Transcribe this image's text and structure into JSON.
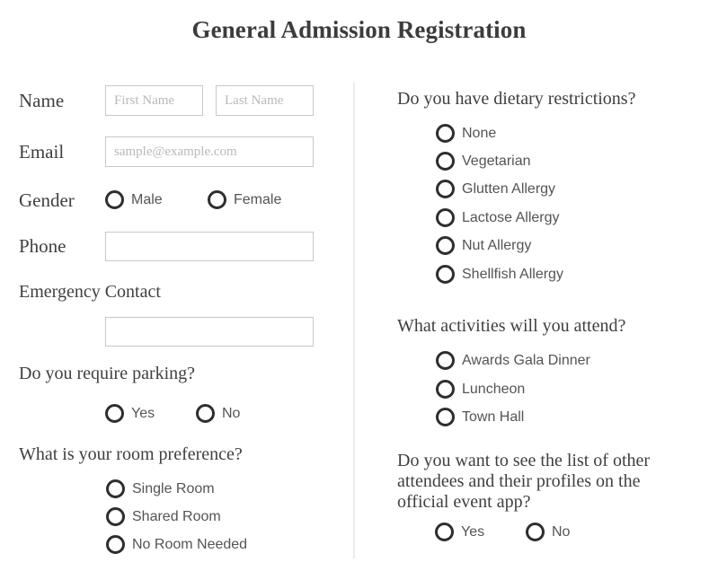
{
  "title": "General Admission Registration",
  "left_column": {
    "name": {
      "label": "Name",
      "first_placeholder": "First Name",
      "first_value": "",
      "last_placeholder": "Last Name",
      "last_value": ""
    },
    "email": {
      "label": "Email",
      "placeholder": "sample@example.com",
      "value": ""
    },
    "gender": {
      "label": "Gender",
      "options": [
        {
          "label": "Male",
          "selected": false
        },
        {
          "label": "Female",
          "selected": false
        }
      ]
    },
    "phone": {
      "label": "Phone",
      "placeholder": "",
      "value": ""
    },
    "emergency_contact": {
      "label": "Emergency Contact",
      "placeholder": "",
      "value": ""
    },
    "parking": {
      "question": "Do you require parking?",
      "options": [
        {
          "label": "Yes",
          "selected": false
        },
        {
          "label": "No",
          "selected": false
        }
      ]
    },
    "room_preference": {
      "question": "What is your room preference?",
      "options": [
        {
          "label": "Single Room",
          "selected": false
        },
        {
          "label": "Shared Room",
          "selected": false
        },
        {
          "label": "No Room Needed",
          "selected": false
        }
      ]
    }
  },
  "right_column": {
    "dietary": {
      "question": "Do you have dietary restrictions?",
      "options": [
        {
          "label": "None",
          "selected": false
        },
        {
          "label": "Vegetarian",
          "selected": false
        },
        {
          "label": "Glutten Allergy",
          "selected": false
        },
        {
          "label": "Lactose Allergy",
          "selected": false
        },
        {
          "label": "Nut Allergy",
          "selected": false
        },
        {
          "label": "Shellfish Allergy",
          "selected": false
        }
      ]
    },
    "activities": {
      "question": "What activities will you attend?",
      "options": [
        {
          "label": "Awards Gala Dinner",
          "selected": false
        },
        {
          "label": "Luncheon",
          "selected": false
        },
        {
          "label": "Town Hall",
          "selected": false
        }
      ]
    },
    "attendee_list": {
      "question": "Do you want to see the list of other attendees and their profiles on the official event app?",
      "options": [
        {
          "label": "Yes",
          "selected": false
        },
        {
          "label": "No",
          "selected": false
        }
      ]
    }
  },
  "colors": {
    "background": "#ffffff",
    "title_text": "#3c3c3c",
    "label_text": "#3f3f3f",
    "option_text": "#545454",
    "input_border": "#c8c8c8",
    "placeholder_text": "#b9b9b9",
    "radio_stroke": "#2e2e2e",
    "divider": "#ececed"
  }
}
